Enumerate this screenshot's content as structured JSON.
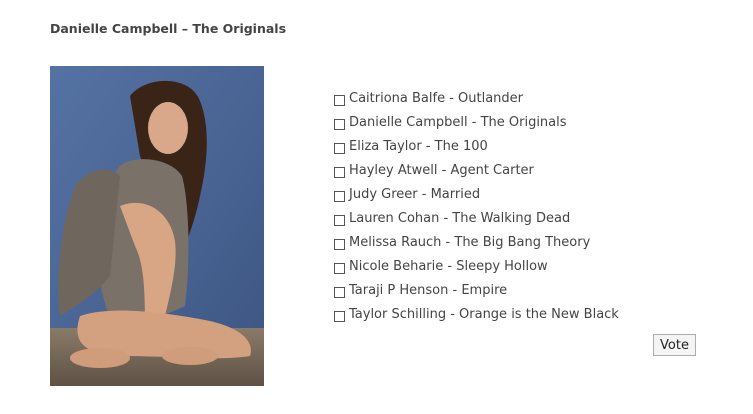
{
  "post": {
    "title": "Danielle Campbell – The Originals"
  },
  "poll": {
    "options": [
      {
        "label": "Caitriona Balfe - Outlander",
        "checked": false
      },
      {
        "label": "Danielle Campbell - The Originals",
        "checked": false
      },
      {
        "label": "Eliza Taylor - The 100",
        "checked": false
      },
      {
        "label": "Hayley Atwell - Agent Carter",
        "checked": false
      },
      {
        "label": "Judy Greer - Married",
        "checked": false
      },
      {
        "label": "Lauren Cohan - The Walking Dead",
        "checked": false
      },
      {
        "label": "Melissa Rauch - The Big Bang Theory",
        "checked": false
      },
      {
        "label": "Nicole Beharie - Sleepy Hollow",
        "checked": false
      },
      {
        "label": "Taraji P Henson - Empire",
        "checked": false
      },
      {
        "label": "Taylor Schilling - Orange is the New Black",
        "checked": false
      }
    ],
    "vote_label": "Vote"
  },
  "colors": {
    "text": "#444444",
    "photo_background": "#4d6897"
  }
}
